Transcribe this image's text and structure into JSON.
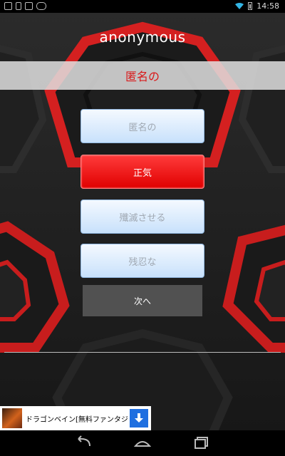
{
  "status_bar": {
    "time": "14:58",
    "left_icons": [
      "image-icon",
      "phone-icon",
      "play-icon",
      "game-controller-icon"
    ],
    "right_icons": [
      "wifi-icon",
      "battery-icon"
    ]
  },
  "app": {
    "title": "anonymous",
    "word": "匿名の",
    "options": [
      {
        "label": "匿名の",
        "state": "normal"
      },
      {
        "label": "正気",
        "state": "selected"
      },
      {
        "label": "殲滅させる",
        "state": "normal"
      },
      {
        "label": "残忍な",
        "state": "normal"
      }
    ],
    "next_label": "次へ"
  },
  "ad": {
    "text": "ドラゴンベイン[無料ファンタジー...",
    "button_icon": "download-icon"
  },
  "nav_bar": {
    "buttons": [
      "back-icon",
      "home-icon",
      "recent-apps-icon"
    ]
  },
  "colors": {
    "accent_red": "#d9191a",
    "selected_button": "#f00000",
    "ad_button": "#1f6fe0"
  }
}
